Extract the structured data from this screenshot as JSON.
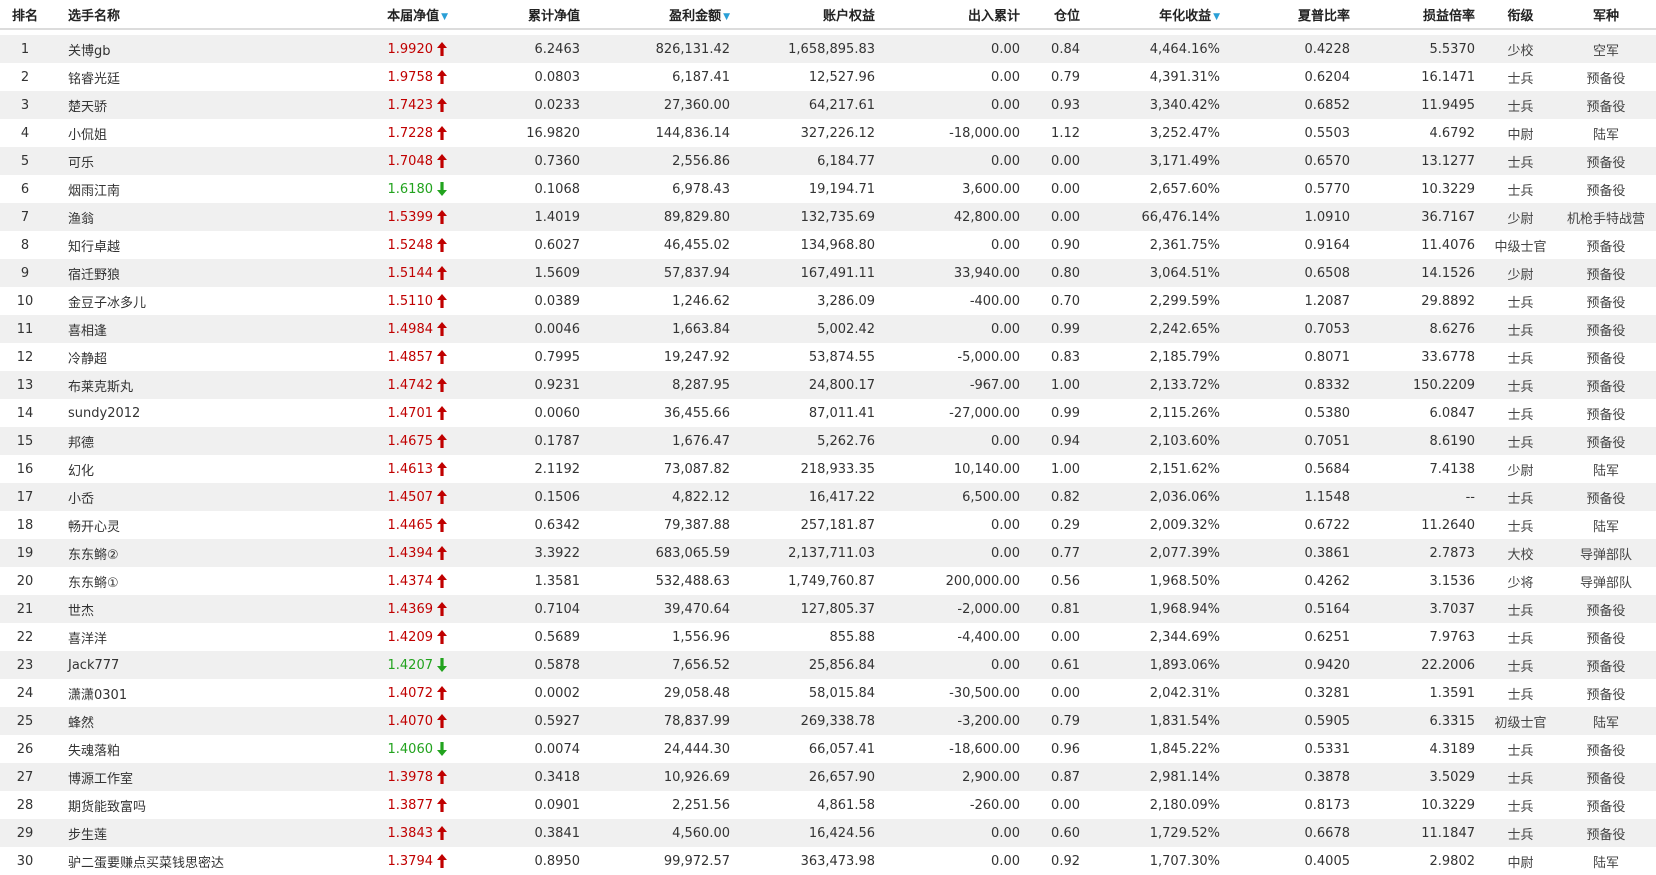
{
  "headers": {
    "rank": "排名",
    "name": "选手名称",
    "nav": "本届净值",
    "cum_nav": "累计净值",
    "profit": "盈利金额",
    "equity": "账户权益",
    "flow": "出入累计",
    "position": "仓位",
    "annual": "年化收益",
    "sharpe": "夏普比率",
    "pl_ratio": "损益倍率",
    "military_rank": "衔级",
    "branch": "军种"
  },
  "colors": {
    "up": "#c00000",
    "down": "#22a31e",
    "sort": "#2a9fd6",
    "stripe": "#f0f0f0"
  },
  "rows": [
    {
      "rank": "1",
      "name": "关博gb",
      "nav": "1.9920",
      "dir": "up",
      "cum": "6.2463",
      "profit": "826,131.42",
      "equity": "1,658,895.83",
      "flow": "0.00",
      "pos": "0.84",
      "annual": "4,464.16%",
      "sharpe": "0.4228",
      "pl": "5.5370",
      "mrank": "少校",
      "branch": "空军"
    },
    {
      "rank": "2",
      "name": "铭睿光廷",
      "nav": "1.9758",
      "dir": "up",
      "cum": "0.0803",
      "profit": "6,187.41",
      "equity": "12,527.96",
      "flow": "0.00",
      "pos": "0.79",
      "annual": "4,391.31%",
      "sharpe": "0.6204",
      "pl": "16.1471",
      "mrank": "士兵",
      "branch": "预备役"
    },
    {
      "rank": "3",
      "name": "楚天骄",
      "nav": "1.7423",
      "dir": "up",
      "cum": "0.0233",
      "profit": "27,360.00",
      "equity": "64,217.61",
      "flow": "0.00",
      "pos": "0.93",
      "annual": "3,340.42%",
      "sharpe": "0.6852",
      "pl": "11.9495",
      "mrank": "士兵",
      "branch": "预备役"
    },
    {
      "rank": "4",
      "name": "小侃姐",
      "nav": "1.7228",
      "dir": "up",
      "cum": "16.9820",
      "profit": "144,836.14",
      "equity": "327,226.12",
      "flow": "-18,000.00",
      "pos": "1.12",
      "annual": "3,252.47%",
      "sharpe": "0.5503",
      "pl": "4.6792",
      "mrank": "中尉",
      "branch": "陆军"
    },
    {
      "rank": "5",
      "name": "可乐",
      "nav": "1.7048",
      "dir": "up",
      "cum": "0.7360",
      "profit": "2,556.86",
      "equity": "6,184.77",
      "flow": "0.00",
      "pos": "0.00",
      "annual": "3,171.49%",
      "sharpe": "0.6570",
      "pl": "13.1277",
      "mrank": "士兵",
      "branch": "预备役"
    },
    {
      "rank": "6",
      "name": "烟雨江南",
      "nav": "1.6180",
      "dir": "down",
      "cum": "0.1068",
      "profit": "6,978.43",
      "equity": "19,194.71",
      "flow": "3,600.00",
      "pos": "0.00",
      "annual": "2,657.60%",
      "sharpe": "0.5770",
      "pl": "10.3229",
      "mrank": "士兵",
      "branch": "预备役"
    },
    {
      "rank": "7",
      "name": "渔翁",
      "nav": "1.5399",
      "dir": "up",
      "cum": "1.4019",
      "profit": "89,829.80",
      "equity": "132,735.69",
      "flow": "42,800.00",
      "pos": "0.00",
      "annual": "66,476.14%",
      "sharpe": "1.0910",
      "pl": "36.7167",
      "mrank": "少尉",
      "branch": "机枪手特战营"
    },
    {
      "rank": "8",
      "name": "知行卓越",
      "nav": "1.5248",
      "dir": "up",
      "cum": "0.6027",
      "profit": "46,455.02",
      "equity": "134,968.80",
      "flow": "0.00",
      "pos": "0.90",
      "annual": "2,361.75%",
      "sharpe": "0.9164",
      "pl": "11.4076",
      "mrank": "中级士官",
      "branch": "预备役"
    },
    {
      "rank": "9",
      "name": "宿迁野狼",
      "nav": "1.5144",
      "dir": "up",
      "cum": "1.5609",
      "profit": "57,837.94",
      "equity": "167,491.11",
      "flow": "33,940.00",
      "pos": "0.80",
      "annual": "3,064.51%",
      "sharpe": "0.6508",
      "pl": "14.1526",
      "mrank": "少尉",
      "branch": "预备役"
    },
    {
      "rank": "10",
      "name": "金豆子冰多儿",
      "nav": "1.5110",
      "dir": "up",
      "cum": "0.0389",
      "profit": "1,246.62",
      "equity": "3,286.09",
      "flow": "-400.00",
      "pos": "0.70",
      "annual": "2,299.59%",
      "sharpe": "1.2087",
      "pl": "29.8892",
      "mrank": "士兵",
      "branch": "预备役"
    },
    {
      "rank": "11",
      "name": "喜相逢",
      "nav": "1.4984",
      "dir": "up",
      "cum": "0.0046",
      "profit": "1,663.84",
      "equity": "5,002.42",
      "flow": "0.00",
      "pos": "0.99",
      "annual": "2,242.65%",
      "sharpe": "0.7053",
      "pl": "8.6276",
      "mrank": "士兵",
      "branch": "预备役"
    },
    {
      "rank": "12",
      "name": "冷静超",
      "nav": "1.4857",
      "dir": "up",
      "cum": "0.7995",
      "profit": "19,247.92",
      "equity": "53,874.55",
      "flow": "-5,000.00",
      "pos": "0.83",
      "annual": "2,185.79%",
      "sharpe": "0.8071",
      "pl": "33.6778",
      "mrank": "士兵",
      "branch": "预备役"
    },
    {
      "rank": "13",
      "name": "布莱克斯丸",
      "nav": "1.4742",
      "dir": "up",
      "cum": "0.9231",
      "profit": "8,287.95",
      "equity": "24,800.17",
      "flow": "-967.00",
      "pos": "1.00",
      "annual": "2,133.72%",
      "sharpe": "0.8332",
      "pl": "150.2209",
      "mrank": "士兵",
      "branch": "预备役"
    },
    {
      "rank": "14",
      "name": "sundy2012",
      "nav": "1.4701",
      "dir": "up",
      "cum": "0.0060",
      "profit": "36,455.66",
      "equity": "87,011.41",
      "flow": "-27,000.00",
      "pos": "0.99",
      "annual": "2,115.26%",
      "sharpe": "0.5380",
      "pl": "6.0847",
      "mrank": "士兵",
      "branch": "预备役"
    },
    {
      "rank": "15",
      "name": "邦德",
      "nav": "1.4675",
      "dir": "up",
      "cum": "0.1787",
      "profit": "1,676.47",
      "equity": "5,262.76",
      "flow": "0.00",
      "pos": "0.94",
      "annual": "2,103.60%",
      "sharpe": "0.7051",
      "pl": "8.6190",
      "mrank": "士兵",
      "branch": "预备役"
    },
    {
      "rank": "16",
      "name": "幻化",
      "nav": "1.4613",
      "dir": "up",
      "cum": "2.1192",
      "profit": "73,087.82",
      "equity": "218,933.35",
      "flow": "10,140.00",
      "pos": "1.00",
      "annual": "2,151.62%",
      "sharpe": "0.5684",
      "pl": "7.4138",
      "mrank": "少尉",
      "branch": "陆军"
    },
    {
      "rank": "17",
      "name": "小岙",
      "nav": "1.4507",
      "dir": "up",
      "cum": "0.1506",
      "profit": "4,822.12",
      "equity": "16,417.22",
      "flow": "6,500.00",
      "pos": "0.82",
      "annual": "2,036.06%",
      "sharpe": "1.1548",
      "pl": "--",
      "mrank": "士兵",
      "branch": "预备役"
    },
    {
      "rank": "18",
      "name": "畅开心灵",
      "nav": "1.4465",
      "dir": "up",
      "cum": "0.6342",
      "profit": "79,387.88",
      "equity": "257,181.87",
      "flow": "0.00",
      "pos": "0.29",
      "annual": "2,009.32%",
      "sharpe": "0.6722",
      "pl": "11.2640",
      "mrank": "士兵",
      "branch": "陆军"
    },
    {
      "rank": "19",
      "name": "东东鳉②",
      "nav": "1.4394",
      "dir": "up",
      "cum": "3.3922",
      "profit": "683,065.59",
      "equity": "2,137,711.03",
      "flow": "0.00",
      "pos": "0.77",
      "annual": "2,077.39%",
      "sharpe": "0.3861",
      "pl": "2.7873",
      "mrank": "大校",
      "branch": "导弹部队"
    },
    {
      "rank": "20",
      "name": "东东鳉①",
      "nav": "1.4374",
      "dir": "up",
      "cum": "1.3581",
      "profit": "532,488.63",
      "equity": "1,749,760.87",
      "flow": "200,000.00",
      "pos": "0.56",
      "annual": "1,968.50%",
      "sharpe": "0.4262",
      "pl": "3.1536",
      "mrank": "少将",
      "branch": "导弹部队"
    },
    {
      "rank": "21",
      "name": "世杰",
      "nav": "1.4369",
      "dir": "up",
      "cum": "0.7104",
      "profit": "39,470.64",
      "equity": "127,805.37",
      "flow": "-2,000.00",
      "pos": "0.81",
      "annual": "1,968.94%",
      "sharpe": "0.5164",
      "pl": "3.7037",
      "mrank": "士兵",
      "branch": "预备役"
    },
    {
      "rank": "22",
      "name": "喜洋洋",
      "nav": "1.4209",
      "dir": "up",
      "cum": "0.5689",
      "profit": "1,556.96",
      "equity": "855.88",
      "flow": "-4,400.00",
      "pos": "0.00",
      "annual": "2,344.69%",
      "sharpe": "0.6251",
      "pl": "7.9763",
      "mrank": "士兵",
      "branch": "预备役"
    },
    {
      "rank": "23",
      "name": "Jack777",
      "nav": "1.4207",
      "dir": "down",
      "cum": "0.5878",
      "profit": "7,656.52",
      "equity": "25,856.84",
      "flow": "0.00",
      "pos": "0.61",
      "annual": "1,893.06%",
      "sharpe": "0.9420",
      "pl": "22.2006",
      "mrank": "士兵",
      "branch": "预备役"
    },
    {
      "rank": "24",
      "name": "潇潇0301",
      "nav": "1.4072",
      "dir": "up",
      "cum": "0.0002",
      "profit": "29,058.48",
      "equity": "58,015.84",
      "flow": "-30,500.00",
      "pos": "0.00",
      "annual": "2,042.31%",
      "sharpe": "0.3281",
      "pl": "1.3591",
      "mrank": "士兵",
      "branch": "预备役"
    },
    {
      "rank": "25",
      "name": "蜂然",
      "nav": "1.4070",
      "dir": "up",
      "cum": "0.5927",
      "profit": "78,837.99",
      "equity": "269,338.78",
      "flow": "-3,200.00",
      "pos": "0.79",
      "annual": "1,831.54%",
      "sharpe": "0.5905",
      "pl": "6.3315",
      "mrank": "初级士官",
      "branch": "陆军"
    },
    {
      "rank": "26",
      "name": "失魂落粕",
      "nav": "1.4060",
      "dir": "down",
      "cum": "0.0074",
      "profit": "24,444.30",
      "equity": "66,057.41",
      "flow": "-18,600.00",
      "pos": "0.96",
      "annual": "1,845.22%",
      "sharpe": "0.5331",
      "pl": "4.3189",
      "mrank": "士兵",
      "branch": "预备役"
    },
    {
      "rank": "27",
      "name": "博源工作室",
      "nav": "1.3978",
      "dir": "up",
      "cum": "0.3418",
      "profit": "10,926.69",
      "equity": "26,657.90",
      "flow": "2,900.00",
      "pos": "0.87",
      "annual": "2,981.14%",
      "sharpe": "0.3878",
      "pl": "3.5029",
      "mrank": "士兵",
      "branch": "预备役"
    },
    {
      "rank": "28",
      "name": "期货能致富吗",
      "nav": "1.3877",
      "dir": "up",
      "cum": "0.0901",
      "profit": "2,251.56",
      "equity": "4,861.58",
      "flow": "-260.00",
      "pos": "0.00",
      "annual": "2,180.09%",
      "sharpe": "0.8173",
      "pl": "10.3229",
      "mrank": "士兵",
      "branch": "预备役"
    },
    {
      "rank": "29",
      "name": "步生莲",
      "nav": "1.3843",
      "dir": "up",
      "cum": "0.3841",
      "profit": "4,560.00",
      "equity": "16,424.56",
      "flow": "0.00",
      "pos": "0.60",
      "annual": "1,729.52%",
      "sharpe": "0.6678",
      "pl": "11.1847",
      "mrank": "士兵",
      "branch": "预备役"
    },
    {
      "rank": "30",
      "name": "驴二蛋要赚点买菜钱思密达",
      "nav": "1.3794",
      "dir": "up",
      "cum": "0.8950",
      "profit": "99,972.57",
      "equity": "363,473.98",
      "flow": "0.00",
      "pos": "0.92",
      "annual": "1,707.30%",
      "sharpe": "0.4005",
      "pl": "2.9802",
      "mrank": "中尉",
      "branch": "陆军"
    }
  ]
}
